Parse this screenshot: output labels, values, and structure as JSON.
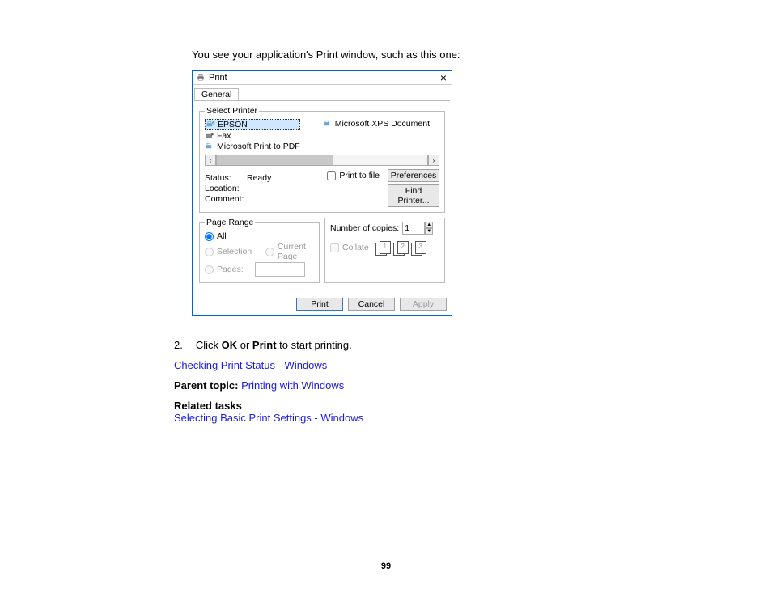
{
  "caption": "You see your application's Print window, such as this one:",
  "dialog": {
    "title": "Print",
    "tab": "General",
    "select_printer": {
      "legend": "Select Printer",
      "items": [
        "EPSON",
        "Fax",
        "Microsoft Print to PDF",
        "Microsoft XPS Document"
      ],
      "selected_index": 0
    },
    "status": {
      "status_label": "Status:",
      "status_value": "Ready",
      "location_label": "Location:",
      "location_value": "",
      "comment_label": "Comment:",
      "comment_value": "",
      "print_to_file": "Print to file",
      "preferences": "Preferences",
      "find_printer": "Find Printer..."
    },
    "page_range": {
      "legend": "Page Range",
      "all": "All",
      "selection": "Selection",
      "current_page": "Current Page",
      "pages": "Pages:"
    },
    "copies": {
      "label": "Number of copies:",
      "value": "1",
      "collate": "Collate",
      "pairs": [
        "1",
        "2",
        "3"
      ]
    },
    "actions": {
      "print": "Print",
      "cancel": "Cancel",
      "apply": "Apply"
    }
  },
  "step": {
    "num": "2.",
    "prefix": "Click ",
    "b1": "OK",
    "mid": " or ",
    "b2": "Print",
    "suffix": " to start printing."
  },
  "topic_link": "Checking Print Status - Windows",
  "parent_label": "Parent topic: ",
  "parent_link": "Printing with Windows",
  "related_heading": "Related tasks",
  "related_link": "Selecting Basic Print Settings - Windows",
  "page_number": "99"
}
